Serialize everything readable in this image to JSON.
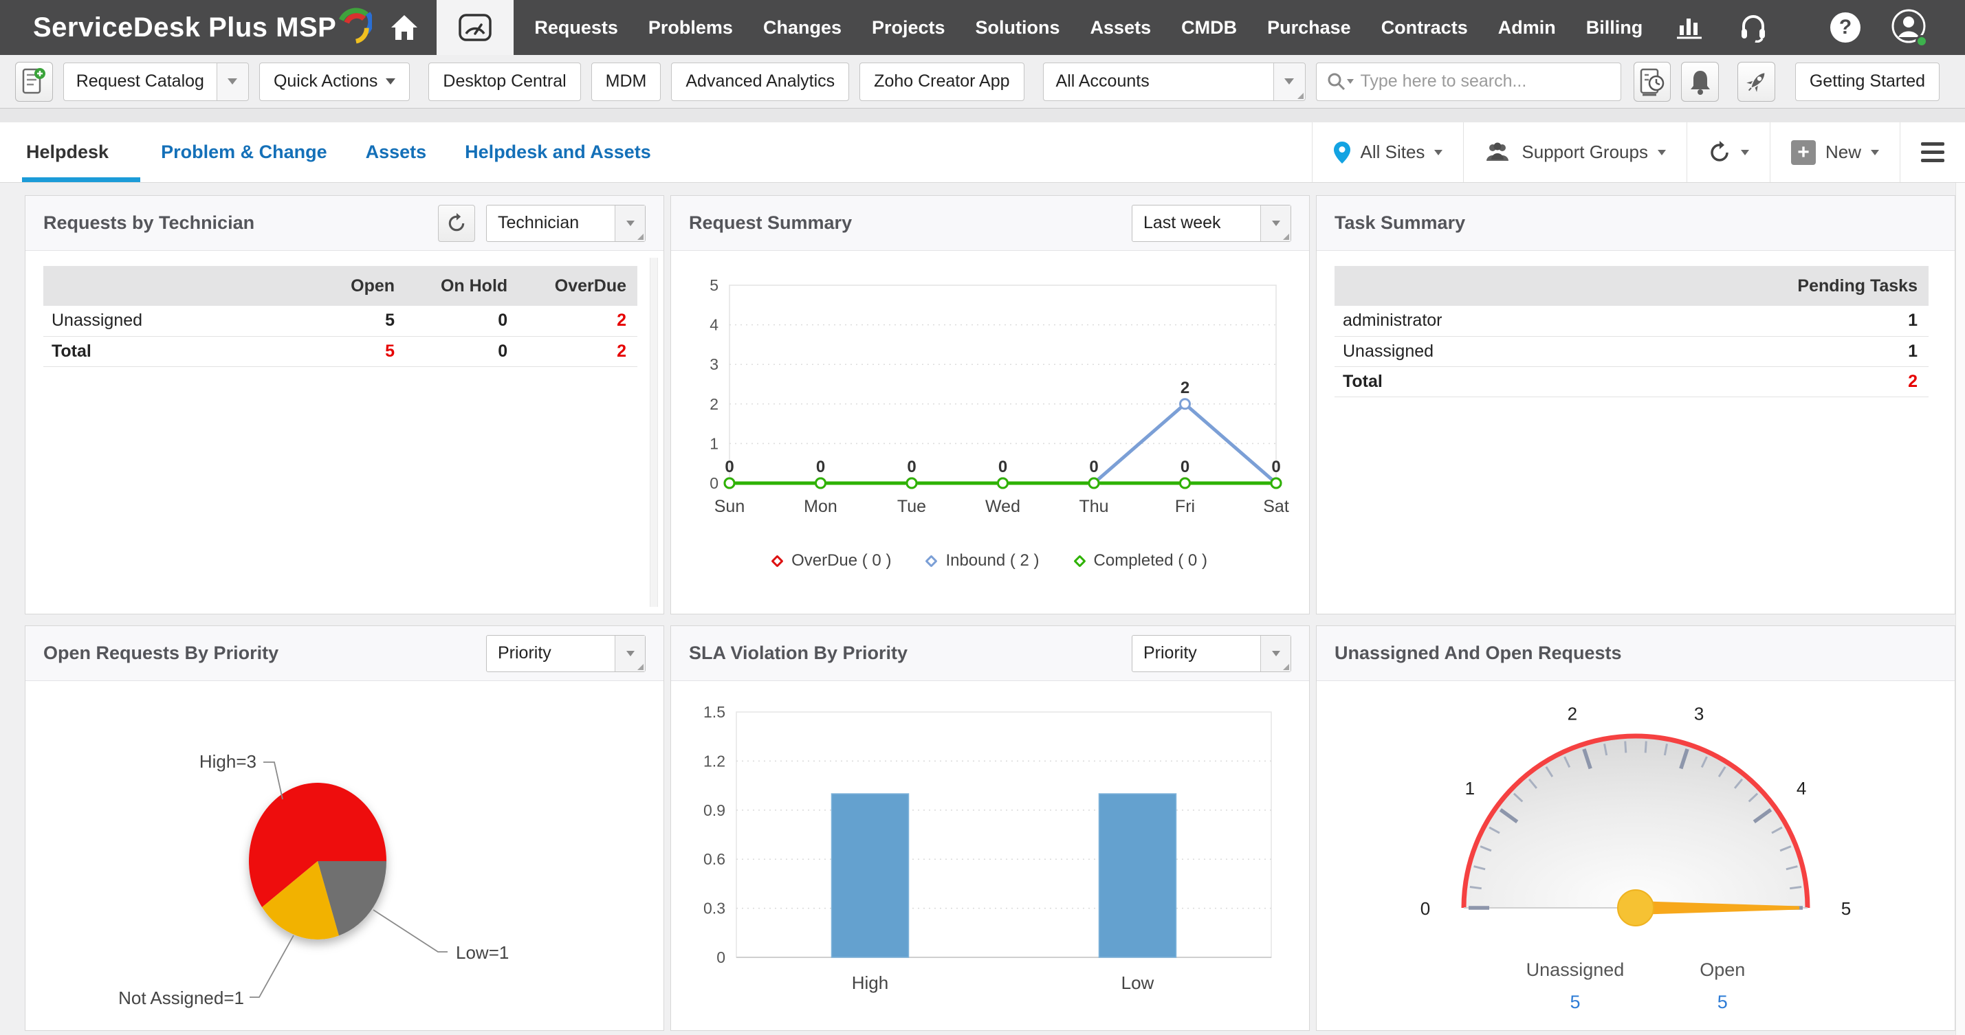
{
  "brand": {
    "logo_text": "ServiceDesk Plus MSP"
  },
  "nav": {
    "items": [
      "Requests",
      "Problems",
      "Changes",
      "Projects",
      "Solutions",
      "Assets",
      "CMDB",
      "Purchase",
      "Contracts",
      "Admin",
      "Billing"
    ]
  },
  "toolbar": {
    "request_catalog": "Request Catalog",
    "quick_actions": "Quick Actions",
    "desktop_central": "Desktop Central",
    "mdm": "MDM",
    "advanced_analytics": "Advanced Analytics",
    "zoho_creator_app": "Zoho Creator App",
    "accounts_select": "All Accounts",
    "search_placeholder": "Type here to search...",
    "getting_started": "Getting Started"
  },
  "tabs": {
    "items": [
      "Helpdesk",
      "Problem & Change",
      "Assets",
      "Helpdesk and Assets"
    ]
  },
  "filters": {
    "all_sites": "All Sites",
    "support_groups": "Support Groups",
    "new_button": "New"
  },
  "cards": {
    "requests_by_technician": {
      "title": "Requests by Technician",
      "dropdown": "Technician",
      "table": {
        "headers": [
          "",
          "Open",
          "On Hold",
          "OverDue"
        ],
        "rows": [
          {
            "name": "Unassigned",
            "open": "5",
            "on_hold": "0",
            "overdue": "2"
          },
          {
            "name": "Total",
            "open": "5",
            "on_hold": "0",
            "overdue": "2"
          }
        ]
      }
    },
    "request_summary": {
      "title": "Request Summary",
      "dropdown": "Last week"
    },
    "task_summary": {
      "title": "Task Summary",
      "table": {
        "header": "Pending Tasks",
        "rows": [
          {
            "name": "administrator",
            "value": "1"
          },
          {
            "name": "Unassigned",
            "value": "1"
          },
          {
            "name": "Total",
            "value": "2"
          }
        ]
      }
    },
    "open_requests_by_priority": {
      "title": "Open Requests By Priority",
      "dropdown": "Priority"
    },
    "sla_violation": {
      "title": "SLA Violation By Priority",
      "dropdown": "Priority"
    },
    "unassigned_open": {
      "title": "Unassigned And Open Requests",
      "stats": [
        {
          "label": "Unassigned",
          "value": "5"
        },
        {
          "label": "Open",
          "value": "5"
        }
      ]
    }
  },
  "chart_data": [
    {
      "id": "request_summary_line",
      "type": "line",
      "title": "Request Summary",
      "categories": [
        "Sun",
        "Mon",
        "Tue",
        "Wed",
        "Thu",
        "Fri",
        "Sat"
      ],
      "series": [
        {
          "name": "OverDue",
          "legend": "OverDue ( 0 )",
          "color": "#dd1111",
          "values": [
            0,
            0,
            0,
            0,
            0,
            0,
            0
          ]
        },
        {
          "name": "Inbound",
          "legend": "Inbound ( 2 )",
          "color": "#7b9fd6",
          "values": [
            0,
            0,
            0,
            0,
            0,
            2,
            0
          ]
        },
        {
          "name": "Completed",
          "legend": "Completed ( 0 )",
          "color": "#2db200",
          "values": [
            0,
            0,
            0,
            0,
            0,
            0,
            0
          ]
        }
      ],
      "ylim": [
        0,
        5
      ],
      "yticks": [
        0,
        1,
        2,
        3,
        4,
        5
      ],
      "point_labels": [
        {
          "ci": 0,
          "y": 0,
          "text": "0"
        },
        {
          "ci": 1,
          "y": 0,
          "text": "0"
        },
        {
          "ci": 2,
          "y": 0,
          "text": "0"
        },
        {
          "ci": 3,
          "y": 0,
          "text": "0"
        },
        {
          "ci": 4,
          "y": 0,
          "text": "0"
        },
        {
          "ci": 5,
          "y": 0,
          "text": "0"
        },
        {
          "ci": 5,
          "y": 2,
          "text": "2"
        },
        {
          "ci": 6,
          "y": 0,
          "text": "0"
        }
      ],
      "legend_position": "bottom",
      "grid": "dotted"
    },
    {
      "id": "priority_pie",
      "type": "pie",
      "slices": [
        {
          "name": "High",
          "label": "High=3",
          "value": 3,
          "color": "#ee1111"
        },
        {
          "name": "Low",
          "label": "Low=1",
          "value": 1,
          "color": "#6f6f6f"
        },
        {
          "name": "Not Assigned",
          "label": "Not Assigned=1",
          "value": 1,
          "color": "#f2b200"
        }
      ]
    },
    {
      "id": "sla_bar",
      "type": "bar",
      "categories": [
        "High",
        "Low"
      ],
      "values": [
        1,
        1
      ],
      "bar_color": "#64a1cf",
      "ylim": [
        0,
        1.5
      ],
      "yticks": [
        0,
        0.3,
        0.6,
        0.9,
        1.2,
        1.5
      ],
      "grid": "dotted"
    },
    {
      "id": "unassigned_gauge",
      "type": "gauge",
      "min": 0,
      "max": 5,
      "value": 5,
      "tick_labels": [
        "0",
        "1",
        "2",
        "3",
        "4",
        "5"
      ],
      "arc_color": "#f54141",
      "needle_color": "#f7a81b",
      "hub_color": "#f6c233"
    }
  ]
}
